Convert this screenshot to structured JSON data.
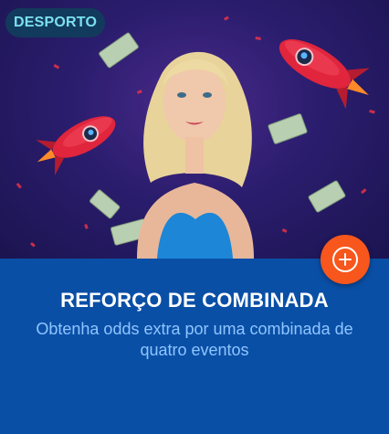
{
  "badge": {
    "label": "DESPORTO"
  },
  "promo": {
    "title": "REFORÇO DE COMBINADA",
    "description": "Obtenha odds extra por uma combinada de quatro eventos"
  },
  "icons": {
    "add": "plus-circle-icon"
  },
  "colors": {
    "hero_background": "#2b1d6e",
    "panel_background": "#0a4fa6",
    "badge_background": "#123a5c",
    "badge_text": "#7be0f0",
    "add_button": "#f7561c",
    "title_text": "#ffffff",
    "description_text": "#8ec5ff"
  }
}
